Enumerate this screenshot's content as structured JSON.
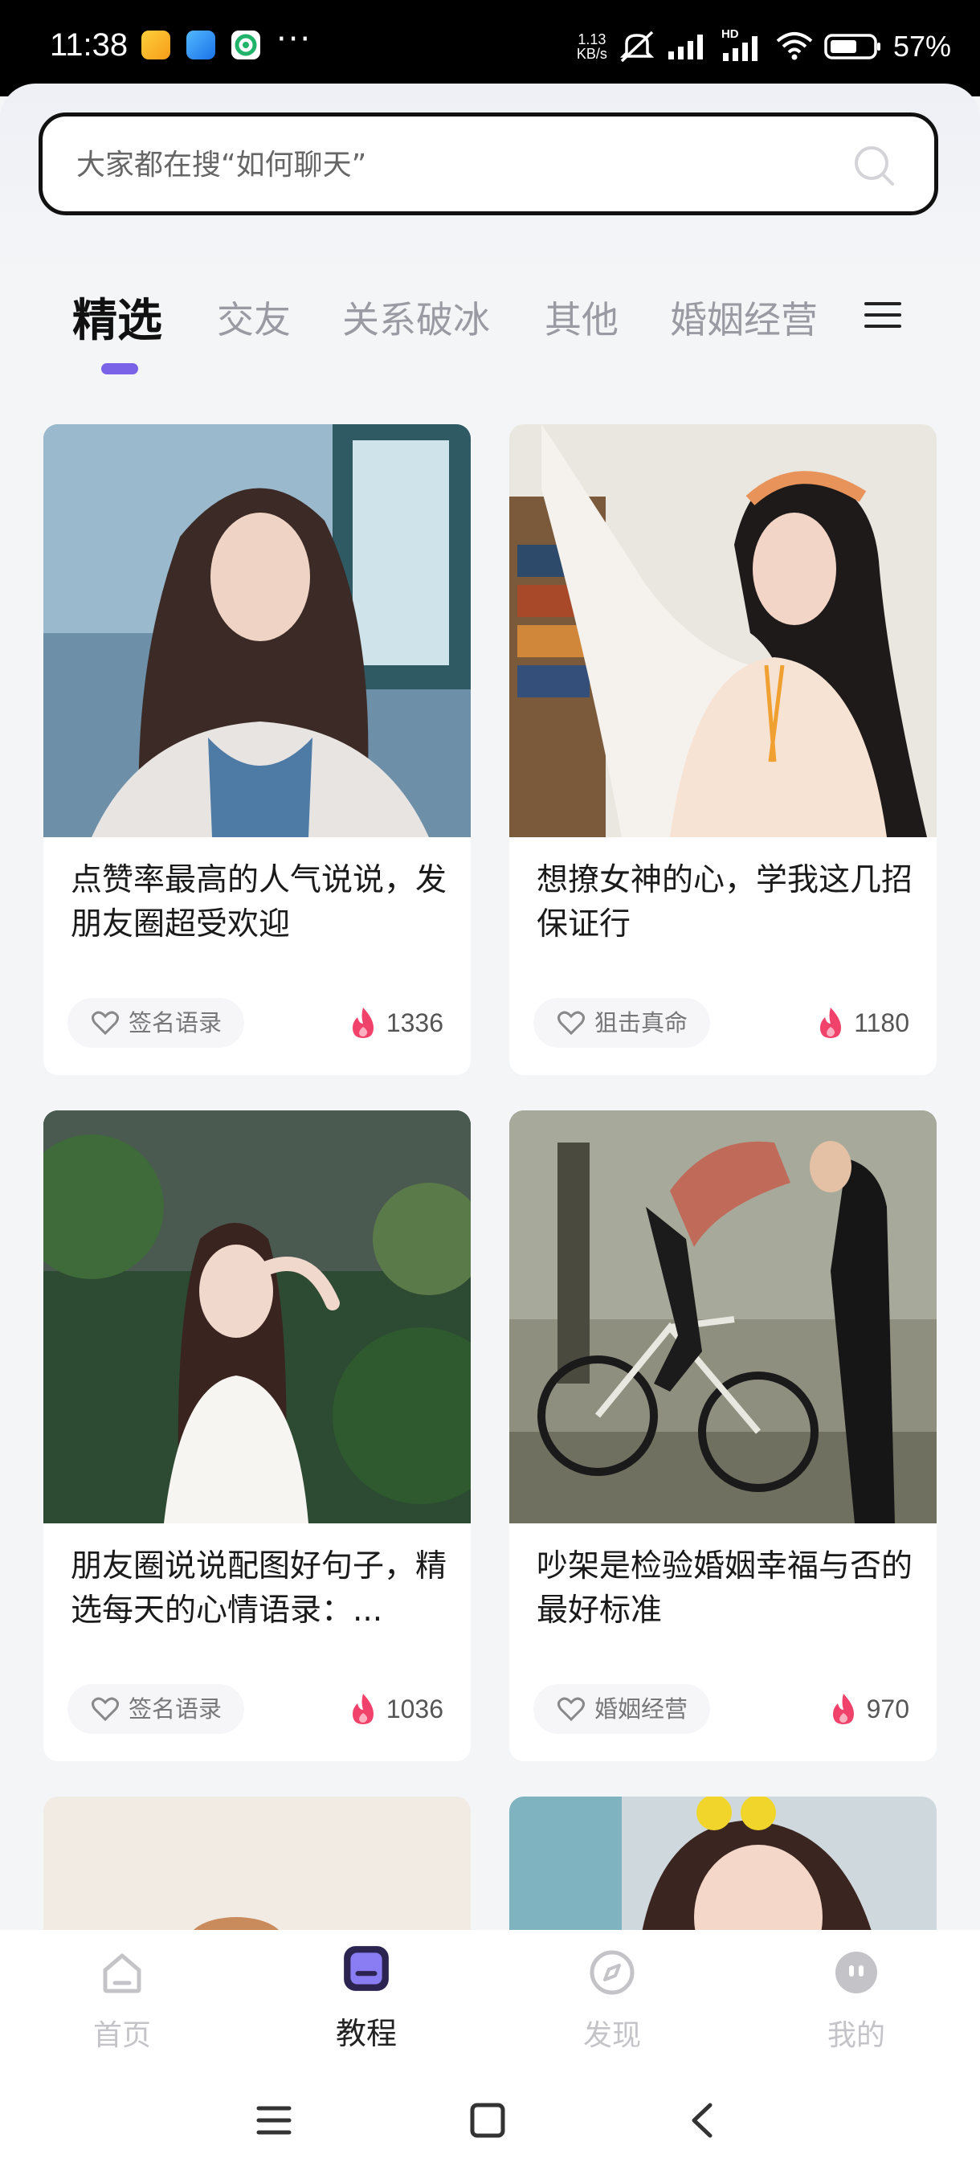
{
  "status_bar": {
    "time": "11:38",
    "more": "···",
    "net_speed_value": "1.13",
    "net_speed_unit": "KB/s",
    "signal_hd": "HD",
    "battery": "57%"
  },
  "search": {
    "placeholder": "大家都在搜“如何聊天”"
  },
  "tabs": [
    {
      "label": "精选",
      "active": true
    },
    {
      "label": "交友"
    },
    {
      "label": "关系破冰"
    },
    {
      "label": "其他"
    },
    {
      "label": "婚姻经营"
    }
  ],
  "cards": [
    {
      "title": "点赞率最高的人气说说，发朋友圈超受欢迎",
      "tag": "签名语录",
      "likes": "1336"
    },
    {
      "title": "想撩女神的心，学我这几招保证行",
      "tag": "狙击真命",
      "likes": "1180"
    },
    {
      "title": "朋友圈说说配图好句子，精选每天的心情语录：...",
      "tag": "签名语录",
      "likes": "1036"
    },
    {
      "title": "吵架是检验婚姻幸福与否的最好标准",
      "tag": "婚姻经营",
      "likes": "970"
    }
  ],
  "bottom_nav": [
    {
      "label": "首页",
      "icon": "home-icon"
    },
    {
      "label": "教程",
      "icon": "tutorial-icon",
      "active": true
    },
    {
      "label": "发现",
      "icon": "compass-icon"
    },
    {
      "label": "我的",
      "icon": "profile-icon"
    }
  ],
  "colors": {
    "accent": "#7a63e6",
    "flame": "#f0426a",
    "active_text": "#111111",
    "inactive_text": "#9a9aa2"
  }
}
